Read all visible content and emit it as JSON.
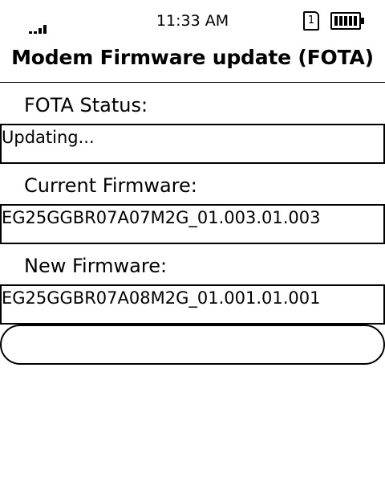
{
  "status_bar": {
    "time": "11:33 AM",
    "sim_slot": "1",
    "signal_icon": "signal-strength-icon",
    "sim_icon": "sim-card-icon",
    "battery_icon": "battery-full-icon",
    "battery_level": 1.0
  },
  "header": {
    "title": "Modem Firmware update (FOTA)"
  },
  "fota_status": {
    "label": "FOTA Status:",
    "value": "Updating..."
  },
  "current_firmware": {
    "label": "Current Firmware:",
    "value": "EG25GGBR07A07M2G_01.003.01.003"
  },
  "new_firmware": {
    "label": "New Firmware:",
    "value": "EG25GGBR07A08M2G_01.001.01.001"
  },
  "progress": {
    "value": 0
  }
}
